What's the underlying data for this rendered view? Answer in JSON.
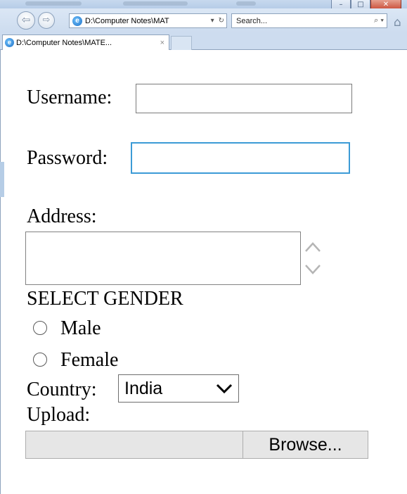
{
  "browser": {
    "address_value": "D:\\Computer Notes\\MAT",
    "search_placeholder": "Search...",
    "tab_title": "D:\\Computer Notes\\MATE...",
    "tab_close": "×"
  },
  "form": {
    "username_label": "Username:",
    "username_value": "",
    "password_label": "Password:",
    "password_value": "",
    "address_label": "Address:",
    "address_value": "",
    "gender_heading": "SELECT GENDER",
    "gender_options": [
      "Male",
      "Female"
    ],
    "country_label": "Country:",
    "country_selected": "India",
    "upload_label": "Upload:",
    "browse_label": "Browse..."
  },
  "colors": {
    "focus_border": "#3c9bd6",
    "chrome_bg": "#cddcef",
    "close_button": "#c6452f"
  },
  "icons": [
    "back-arrow-icon",
    "forward-arrow-icon",
    "ie-page-icon",
    "dropdown-arrow-icon",
    "refresh-icon",
    "search-icon",
    "home-icon",
    "chevron-up-icon",
    "chevron-down-icon"
  ]
}
